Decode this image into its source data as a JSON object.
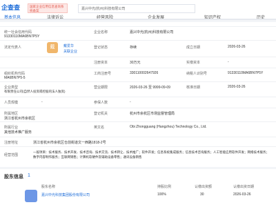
{
  "brand": {
    "name": "企查查",
    "badge": "国家企业信用信息查询系统备案"
  },
  "search": {
    "value": "嘉兴中光(杭州)科技有限公司"
  },
  "nav": {
    "tabs": [
      "基本信息",
      "法律诉讼",
      "经营风险",
      "企业发展",
      "知识产权",
      "历史"
    ]
  },
  "basic": {
    "credit_label": "统一社会信用代码",
    "credit_value": "91330110MA6BN7P5Y",
    "name_label": "企业名称",
    "name_value": "嘉兴中光(杭州)科技有限公司",
    "legal_label": "法定代表人",
    "legal_name": "戴爱华",
    "legal_link": "关联企业",
    "status_label": "登记状态",
    "status_value": "存续",
    "est_label": "成立日期",
    "est_value": "2026-03-26",
    "capital_label": "注册资本",
    "capital_value": "30万元",
    "paidin_label": "实缴资本",
    "paidin_value": "-",
    "org_label": "组织机构代码",
    "org_value": "MA6BN7P5-5",
    "reg_label": "工商注册号",
    "reg_value": "330110002647926",
    "tax_label": "纳税人识别号",
    "tax_value": "91330110MA6BN7P5Y",
    "type_label": "企业类型",
    "type_value": "有限责任公司(自然人投资或控股的法人独资)",
    "term_label": "营业期限",
    "term_value": "2026-03-26 至 9999-09-09",
    "appr_label": "核准日期",
    "appr_value": "2026-03-26",
    "staff_label": "参保人数",
    "staff_value": "-",
    "size_label": "人员规模",
    "size_value": "-",
    "auth_label": "登记机关",
    "auth_value": "杭州市余杭区市场监督管理局",
    "region_label": "所属地区",
    "region_value": "浙江省杭州市余杭区",
    "industry_label": "所属行业",
    "industry_value": "其他技术推广服务",
    "en_label": "英文名",
    "en_value": "Obi Zhongguang (Hangzhou) Technology Co., Ltd.",
    "addr_label": "注册地址",
    "addr_value": "浙江省杭州市余杭区仓前街道文一西路1818-2号",
    "scope_label": "经营范围",
    "scope_value": "一般项目：技术服务、技术开发、技术咨询、技术交流、技术转让、技术推广；软件开发；信息系统集成服务；信息技术咨询服务；人工智能应用软件开发；网络技术服务；数字内容制作服务；互联网销售；计算机软硬件及辅助设备零售；通讯设备销售"
  },
  "bottom": {
    "title": "股东信息",
    "count": "1",
    "col1": "股东名称",
    "col2": "持股比例",
    "col3": "认缴出资额",
    "col4": "认缴出资日期",
    "company": "嘉兴中光科技集团股份有限公司",
    "ratio": "100%",
    "amount": "30",
    "date": "2026-03-26"
  }
}
